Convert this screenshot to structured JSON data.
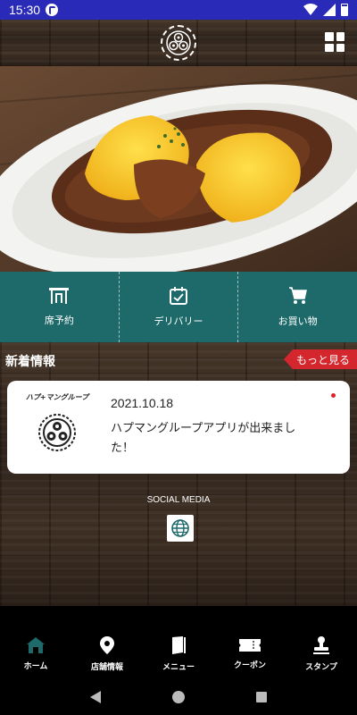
{
  "status_bar": {
    "time": "15:30"
  },
  "actions": [
    {
      "label": "席予約",
      "icon": "table-icon"
    },
    {
      "label": "デリバリー",
      "icon": "calendar-check-icon"
    },
    {
      "label": "お買い物",
      "icon": "cart-icon"
    }
  ],
  "news": {
    "section_title": "新着情報",
    "more_label": "もっと見る",
    "items": [
      {
        "thumb_text": "ハプ+マングループ",
        "date": "2021.10.18",
        "text": "ハプマングループアプリが出来ました！"
      }
    ]
  },
  "social": {
    "label": "SOCIAL MEDIA",
    "icon": "globe-icon"
  },
  "bottom_nav": [
    {
      "label": "ホーム",
      "icon": "home-icon",
      "active": true
    },
    {
      "label": "店舗情報",
      "icon": "location-pin-icon"
    },
    {
      "label": "メニュー",
      "icon": "book-icon"
    },
    {
      "label": "クーポン",
      "icon": "ticket-icon"
    },
    {
      "label": "スタンプ",
      "icon": "stamp-icon"
    }
  ],
  "colors": {
    "status_bar": "#2a2ab8",
    "action_row": "#1e6a6a",
    "more_button": "#d3262d",
    "active_nav": "#1e6a6a"
  }
}
